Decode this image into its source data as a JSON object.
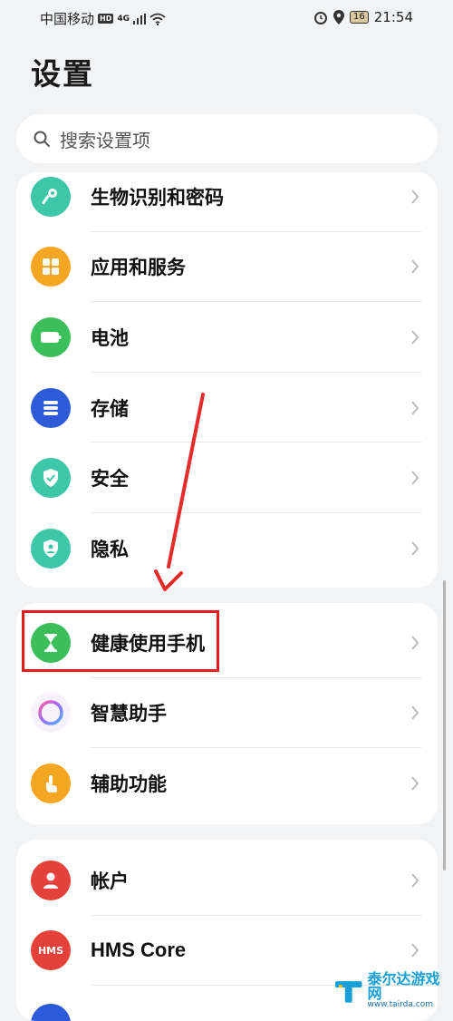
{
  "status_bar": {
    "carrier": "中国移动",
    "hd_badge": "HD",
    "network": "4G",
    "battery": "16",
    "time": "21:54"
  },
  "page_title": "设置",
  "search": {
    "placeholder": "搜索设置项"
  },
  "group1": [
    {
      "label": "生物识别和密码",
      "icon": "key-icon",
      "color": "#3ec6a8"
    },
    {
      "label": "应用和服务",
      "icon": "apps-grid-icon",
      "color": "#f5a623"
    },
    {
      "label": "电池",
      "icon": "battery-icon",
      "color": "#3cbf5a"
    },
    {
      "label": "存储",
      "icon": "storage-icon",
      "color": "#2d5bd8"
    },
    {
      "label": "安全",
      "icon": "shield-check-icon",
      "color": "#3ec6a8"
    },
    {
      "label": "隐私",
      "icon": "privacy-icon",
      "color": "#3ec6a8"
    }
  ],
  "group2": [
    {
      "label": "健康使用手机",
      "icon": "hourglass-icon",
      "color": "#3cbf5a"
    },
    {
      "label": "智慧助手",
      "icon": "assistant-ring-icon",
      "color": "#ffffff"
    },
    {
      "label": "辅助功能",
      "icon": "hand-pointer-icon",
      "color": "#f5a623"
    }
  ],
  "group3": [
    {
      "label": "帐户",
      "icon": "person-icon",
      "color": "#e5413b"
    },
    {
      "label": "HMS Core",
      "icon": "hms-icon",
      "icon_text": "HMS",
      "color": "#e5413b"
    }
  ],
  "watermark": {
    "name": "泰尔达游戏网",
    "url": "www.tairda.com"
  }
}
